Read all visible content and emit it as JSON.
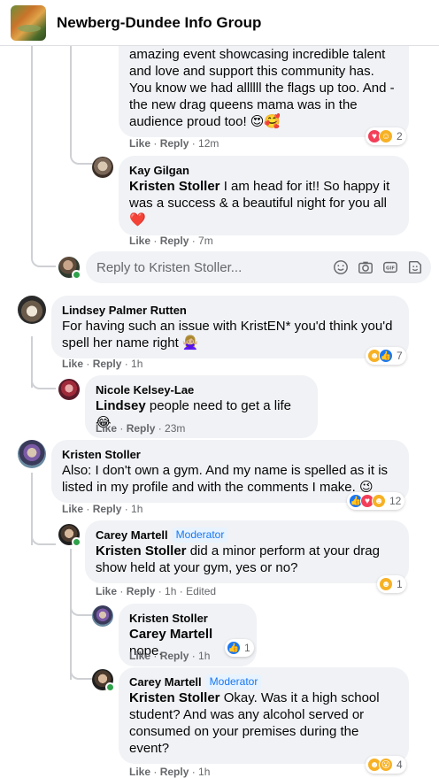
{
  "header": {
    "group_name": "Newberg-Dundee Info Group"
  },
  "comments": {
    "c0": {
      "text": "amazing event showcasing incredible talent and love and support this community has. You know we had allllll the flags up too. And - the new drag queens mama was in the audience proud too! 😍🥰",
      "like": "Like",
      "reply": "Reply",
      "time": "12m",
      "reaction_icons": [
        "love",
        "care"
      ],
      "reaction_count": "2"
    },
    "c1": {
      "author": "Kay Gilgan",
      "mention": "Kristen Stoller",
      "text": " I am head for it!! So happy it was a success & a beautiful night for you all ❤️",
      "like": "Like",
      "reply": "Reply",
      "time": "7m"
    },
    "reply_box": {
      "placeholder": "Reply to Kristen Stoller..."
    },
    "c2": {
      "author": "Lindsey Palmer Rutten",
      "text": "For having such an issue with KristEN* you'd think you'd spell her name right 🙅🏼‍♀️",
      "like": "Like",
      "reply": "Reply",
      "time": "1h",
      "reaction_icons": [
        "haha",
        "like"
      ],
      "reaction_count": "7"
    },
    "c3": {
      "author": "Nicole Kelsey-Lae",
      "mention": "Lindsey",
      "text": " people need to get a life 😂",
      "like": "Like",
      "reply": "Reply",
      "time": "23m"
    },
    "c4": {
      "author": "Kristen Stoller",
      "text": "Also: I don't own a gym. And my name is spelled as it is listed in my profile and with the comments I make. 😉",
      "like": "Like",
      "reply": "Reply",
      "time": "1h",
      "reaction_icons": [
        "like",
        "love",
        "haha"
      ],
      "reaction_count": "12"
    },
    "c5": {
      "author": "Carey Martell",
      "badge": "Moderator",
      "mention": "Kristen Stoller",
      "text": " did a minor perform at your drag show held at your gym, yes or no?",
      "like": "Like",
      "reply": "Reply",
      "time": "1h",
      "edited": "Edited",
      "reaction_icons": [
        "haha"
      ],
      "reaction_count": "1"
    },
    "c6": {
      "author": "Kristen Stoller",
      "mention": "Carey Martell",
      "text": " nope.",
      "like": "Like",
      "reply": "Reply",
      "time": "1h",
      "reaction_icons": [
        "like"
      ],
      "reaction_count": "1"
    },
    "c7": {
      "author": "Carey Martell",
      "badge": "Moderator",
      "mention": "Kristen Stoller",
      "text": " Okay. Was it a high school student? And was any alcohol served or consumed on your premises during the event?",
      "like": "Like",
      "reply": "Reply",
      "time": "1h",
      "reaction_icons": [
        "haha",
        "wow"
      ],
      "reaction_count": "4"
    }
  },
  "colors": {
    "accent": "#1877f2",
    "bubble": "#f0f2f5",
    "meta": "#65676b",
    "online": "#31a24c",
    "love": "#f33e58",
    "haha": "#f7b125"
  }
}
